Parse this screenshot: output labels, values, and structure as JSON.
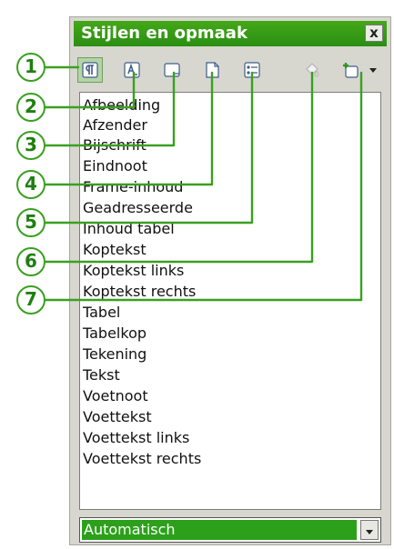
{
  "window": {
    "title": "Stijlen en opmaak",
    "close_label": "x"
  },
  "toolbar": {
    "buttons": [
      {
        "icon": "paragraph-styles-icon",
        "active": true
      },
      {
        "icon": "character-styles-icon"
      },
      {
        "icon": "frame-styles-icon"
      },
      {
        "icon": "page-styles-icon"
      },
      {
        "icon": "list-styles-icon"
      },
      {
        "icon": "fill-format-mode-icon"
      },
      {
        "icon": "new-style-from-selection-icon"
      }
    ]
  },
  "styles_list": [
    "Afbeelding",
    "Afzender",
    "Bijschrift",
    "Eindnoot",
    "Frame-inhoud",
    "Geadresseerde",
    "Inhoud tabel",
    "Koptekst",
    "Koptekst links",
    "Koptekst rechts",
    "Tabel",
    "Tabelkop",
    "Tekening",
    "Tekst",
    "Voetnoot",
    "Voettekst",
    "Voettekst links",
    "Voettekst rechts"
  ],
  "filter_dropdown": {
    "selected": "Automatisch"
  },
  "callouts": [
    "1",
    "2",
    "3",
    "4",
    "5",
    "6",
    "7"
  ],
  "colors": {
    "title_green": "#2f9614",
    "callout_green": "#3aa020",
    "selected_green": "#2ca01a"
  }
}
